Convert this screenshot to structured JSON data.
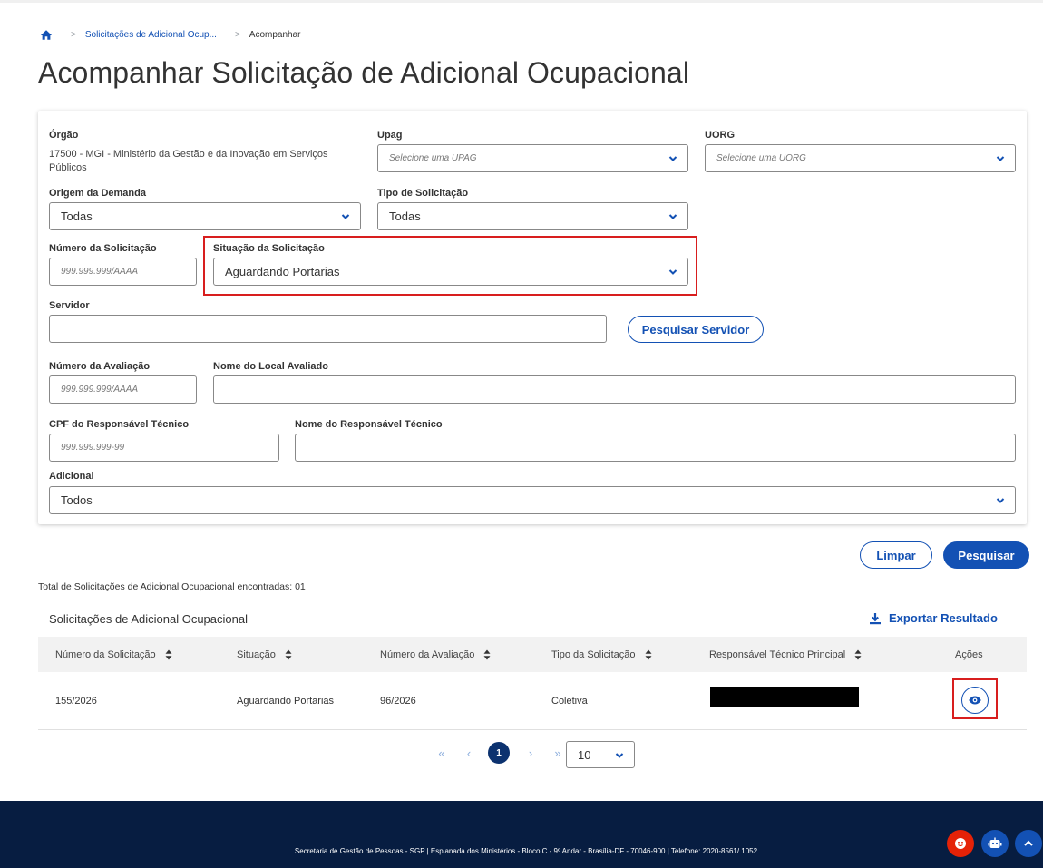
{
  "breadcrumb": {
    "home_icon": "home-icon",
    "items": [
      {
        "label": "Solicitações de Adicional Ocup..."
      },
      {
        "label": "Acompanhar"
      }
    ]
  },
  "page_title": "Acompanhar Solicitação de Adicional Ocupacional",
  "filters": {
    "orgao": {
      "label": "Órgão",
      "value": "17500 - MGI - Ministério da Gestão e da Inovação em Serviços Públicos"
    },
    "upag": {
      "label": "Upag",
      "placeholder": "Selecione uma UPAG"
    },
    "uorg": {
      "label": "UORG",
      "placeholder": "Selecione uma UORG"
    },
    "origem": {
      "label": "Origem da Demanda",
      "value": "Todas"
    },
    "tipo": {
      "label": "Tipo de Solicitação",
      "value": "Todas"
    },
    "numero_solicitacao": {
      "label": "Número da Solicitação",
      "placeholder": "999.999.999/AAAA"
    },
    "situacao": {
      "label": "Situação da Solicitação",
      "value": "Aguardando Portarias"
    },
    "servidor": {
      "label": "Servidor",
      "value": ""
    },
    "pesquisar_servidor": "Pesquisar Servidor",
    "numero_avaliacao": {
      "label": "Número da Avaliação",
      "placeholder": "999.999.999/AAAA"
    },
    "nome_local": {
      "label": "Nome do Local Avaliado",
      "value": ""
    },
    "cpf_responsavel": {
      "label": "CPF do Responsável Técnico",
      "placeholder": "999.999.999-99"
    },
    "nome_responsavel": {
      "label": "Nome do Responsável Técnico",
      "value": ""
    },
    "adicional": {
      "label": "Adicional",
      "value": "Todos"
    }
  },
  "actions": {
    "limpar": "Limpar",
    "pesquisar": "Pesquisar"
  },
  "total_text": "Total de Solicitações de Adicional Ocupacional encontradas: 01",
  "results": {
    "title": "Solicitações de Adicional Ocupacional",
    "export_label": "Exportar Resultado",
    "columns": [
      "Número da Solicitação",
      "Situação",
      "Número da Avaliação",
      "Tipo da Solicitação",
      "Responsável Técnico Principal",
      "Ações"
    ],
    "rows": [
      {
        "numero": "155/2026",
        "situacao": "Aguardando Portarias",
        "avaliacao": "96/2026",
        "tipo": "Coletiva",
        "responsavel": "",
        "acao_icon": "eye-icon"
      }
    ]
  },
  "pagination": {
    "current_page": "1",
    "page_size": "10"
  },
  "footer": {
    "text": "Secretaria de Gestão de Pessoas - SGP | Esplanada dos Ministérios - Bloco C - 9º Andar - Brasília-DF - 70046-900 | Telefone: 2020-8561/ 1052"
  },
  "colors": {
    "primary": "#1351b4",
    "dark_blue": "#071d41",
    "highlight_red": "#d81e1e",
    "fab_red": "#e52207"
  }
}
